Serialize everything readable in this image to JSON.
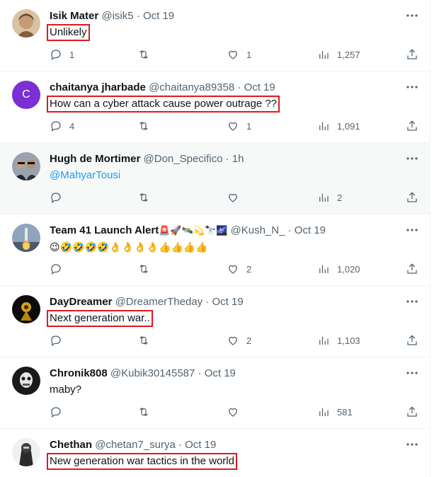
{
  "tweets": [
    {
      "name": "Isik Mater",
      "handle": "@isik5 · Oct 19",
      "text": "Unlikely",
      "replies": "1",
      "likes": "1",
      "views": "1,257",
      "avatar_color": "#b48a6a"
    },
    {
      "name": "chaitanya jharbade",
      "handle": "@chaitanya89358 · Oct 19",
      "text": "How can a cyber attack cause power outrage ??",
      "replies": "4",
      "likes": "1",
      "views": "1,091",
      "avatar_letter": "C",
      "avatar_color": "#7b2fd4"
    },
    {
      "name": "Hugh de Mortimer",
      "handle": "@Don_Specifico · 1h",
      "text": "@MahyarTousi",
      "views": "2",
      "avatar_color": "#4a4a4a"
    },
    {
      "name": "Team 41 Launch Alert",
      "name_emoji": "🚨🚀🛰️💫🔭🌌",
      "handle": "@Kush_N_ · Oct 19",
      "text": "😉🤣🤣🤣🤣👌👌👌👌👍👍👍👍",
      "likes": "2",
      "views": "1,020",
      "avatar_color": "#5b6f86"
    },
    {
      "name": "DayDreamer",
      "handle": "@DreamerTheday · Oct 19",
      "text": "Next generation war..",
      "likes": "2",
      "views": "1,103",
      "avatar_color": "#111111"
    },
    {
      "name": "Chronik808",
      "handle": "@Kubik30145587 · Oct 19",
      "text": "maby?",
      "views": "581",
      "avatar_color": "#222222"
    },
    {
      "name": "Chethan",
      "handle": "@chetan7_surya · Oct 19",
      "text": "New generation war tactics in the world",
      "avatar_color": "#333333"
    }
  ],
  "colors": {
    "highlight_box": "#e0191e",
    "link": "#1d9bf0",
    "secondary_text": "#536471",
    "hover_row": "#f7f9f9"
  },
  "icons": [
    "reply-icon",
    "retweet-icon",
    "like-icon",
    "views-icon",
    "share-icon",
    "more-icon"
  ]
}
